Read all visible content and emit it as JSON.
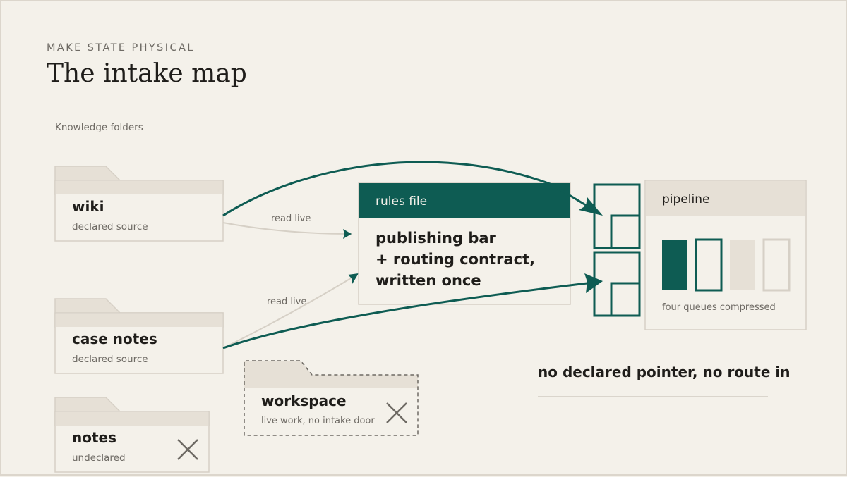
{
  "header": {
    "eyebrow": "MAKE STATE PHYSICAL",
    "title": "The intake map",
    "section_label": "Knowledge folders"
  },
  "folders": {
    "wiki": {
      "name": "wiki",
      "status": "declared source"
    },
    "case_notes": {
      "name": "case notes",
      "status": "declared source"
    },
    "notes": {
      "name": "notes",
      "status": "undeclared"
    },
    "workspace": {
      "name": "workspace",
      "status": "live work, no intake door"
    }
  },
  "edges": {
    "wiki_read": "read live",
    "case_notes_read": "read live"
  },
  "rules_file": {
    "header": "rules file",
    "line1": "publishing bar",
    "line2": "+ routing contract,",
    "line3": "written once"
  },
  "pipeline": {
    "label": "pipeline",
    "caption": "four queues compressed",
    "queues": [
      {
        "state": "filled"
      },
      {
        "state": "outlined"
      },
      {
        "state": "muted-filled"
      },
      {
        "state": "muted-outlined"
      }
    ]
  },
  "callout": "no declared pointer, no route in",
  "colors": {
    "background": "#f4f1ea",
    "accent": "#0e5c53",
    "folder_fill": "#f4f1ea",
    "folder_tab": "#e6e0d6",
    "folder_border": "#d6d0c6",
    "muted_text": "#6e6a64",
    "ink": "#1f1d1a"
  },
  "icons": {
    "undeclared_mark": "x-icon",
    "queue_door": "intake-door-icon"
  }
}
